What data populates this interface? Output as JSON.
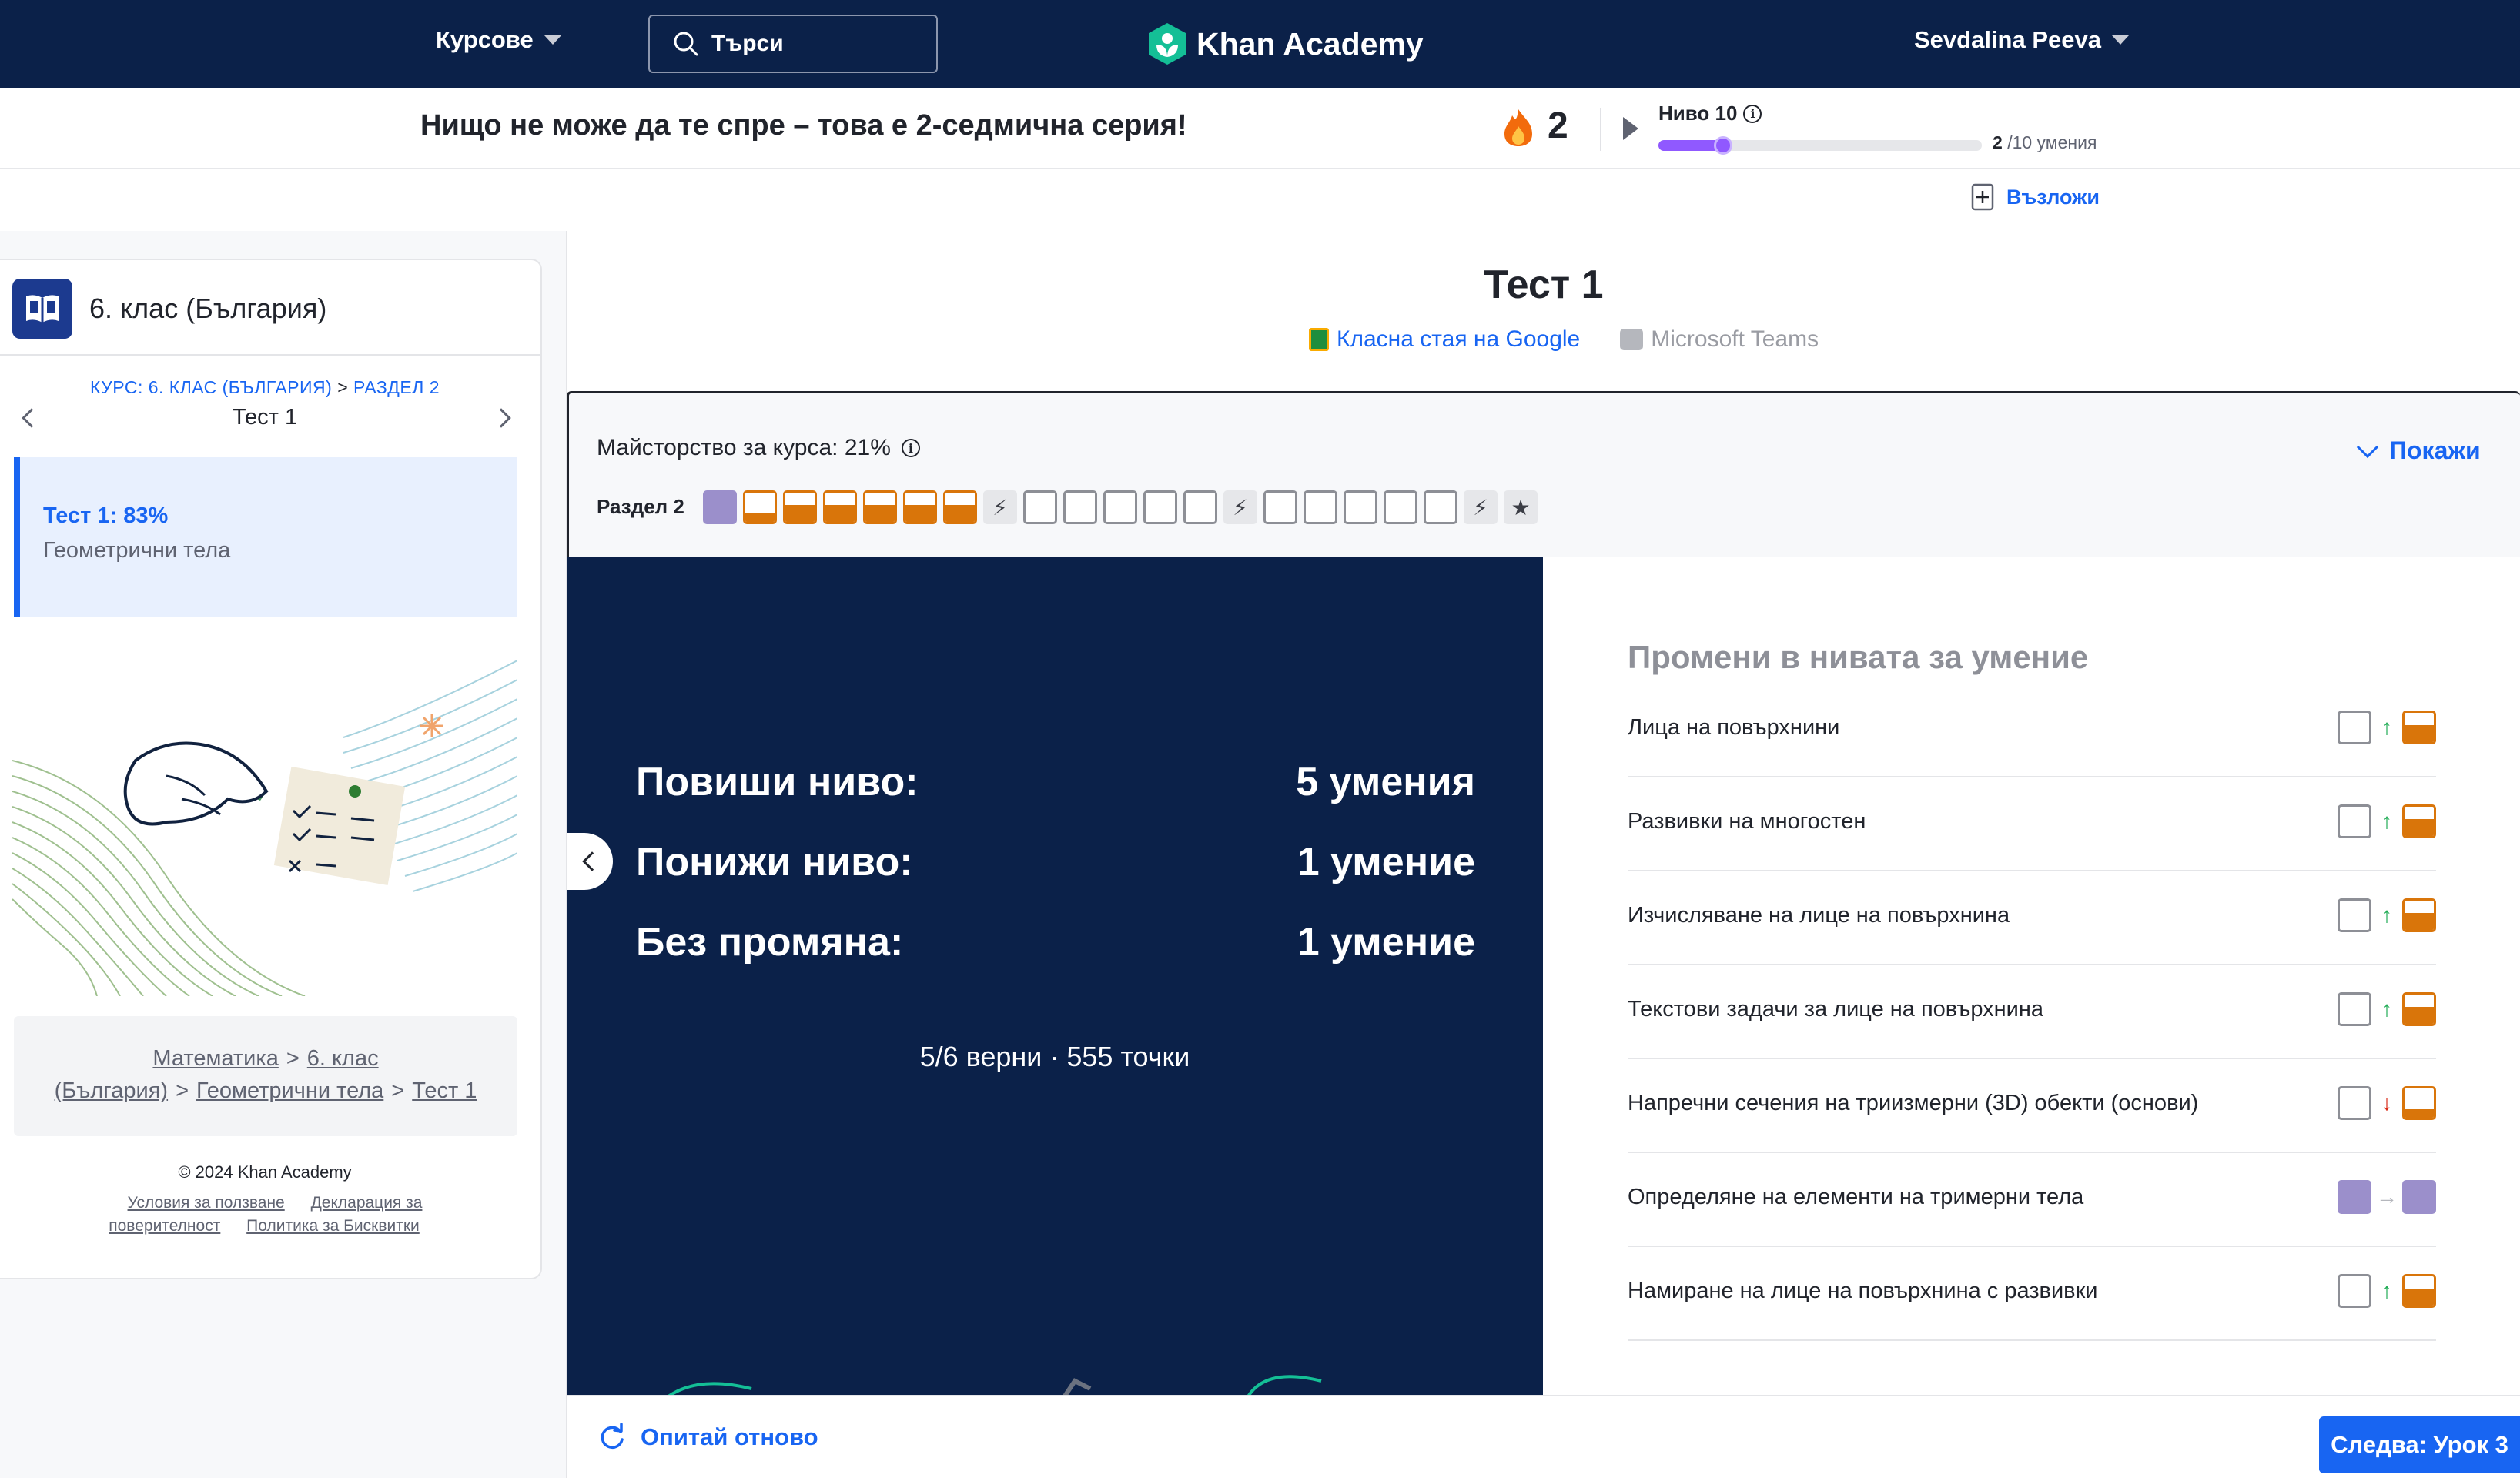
{
  "nav": {
    "courses_label": "Курсове",
    "search_placeholder": "Търси",
    "logo_text": "Khan Academy",
    "user_name": "Sevdalina Peeva"
  },
  "streak": {
    "message": "Нищо не може да те спре – това е 2-седмична серия!",
    "count": "2",
    "level_label": "Ниво 10",
    "skills_done": "2",
    "skills_total": "/10 умения",
    "level_progress": 0.2
  },
  "assign_label": "Възложи",
  "sidebar": {
    "course_title": "6. клас (България)",
    "crumb_course": "КУРС: 6. КЛАС (БЪЛГАРИЯ)",
    "crumb_sep": ">",
    "crumb_unit": "РАЗДЕЛ 2",
    "current_title": "Тест 1",
    "active_item_title": "Тест 1: 83%",
    "active_item_subtitle": "Геометрични тела",
    "breadcrumb": [
      "Математика",
      "6. клас (България)",
      "Геометрични тела",
      "Тест 1"
    ],
    "copyright": "© 2024 Khan Academy",
    "footer_links": [
      "Условия за ползване",
      "Декларация за поверителност",
      "Политика за Бисквитки"
    ]
  },
  "main": {
    "title": "Тест 1",
    "google_classroom": "Класна стая на Google",
    "ms_teams": "Microsoft Teams",
    "mastery_label": "Майсторство за курса: 21%",
    "show_label": "Покажи",
    "unit_label": "Раздел 2",
    "unit_boxes": [
      "mastered",
      "familiar",
      "proficient",
      "proficient",
      "proficient",
      "proficient",
      "proficient",
      "quiz",
      "empty",
      "empty",
      "empty",
      "empty",
      "empty",
      "quiz",
      "empty",
      "empty",
      "empty",
      "empty",
      "empty",
      "quiz",
      "challenge"
    ]
  },
  "results": {
    "leveled_up_label": "Повиши ниво:",
    "leveled_up_value": "5 умения",
    "leveled_down_label": "Понижи ниво:",
    "leveled_down_value": "1 умение",
    "no_change_label": "Без промяна:",
    "no_change_value": "1 умение",
    "score": "5/6 верни · 555 точки"
  },
  "skill_changes": {
    "title": "Промени в нивата за умение",
    "rows": [
      {
        "name": "Лица на повърхнини",
        "from": "empty",
        "dir": "up",
        "to": "proficient"
      },
      {
        "name": "Развивки на многостен",
        "from": "empty",
        "dir": "up",
        "to": "proficient"
      },
      {
        "name": "Изчисляване на лице на повърхнина",
        "from": "empty",
        "dir": "up",
        "to": "proficient"
      },
      {
        "name": "Текстови задачи за лице на повърхнина",
        "from": "empty",
        "dir": "up",
        "to": "proficient"
      },
      {
        "name": "Напречни сечения на триизмерни (3D) обекти (основи)",
        "from": "empty",
        "dir": "down",
        "to": "familiar"
      },
      {
        "name": "Определяне на елементи на тримерни тела",
        "from": "mastered",
        "dir": "same",
        "to": "mastered"
      },
      {
        "name": "Намиране на лице на повърхнина с развивки",
        "from": "empty",
        "dir": "up",
        "to": "proficient"
      }
    ]
  },
  "bottom": {
    "retry_label": "Опитай отново",
    "next_label": "Следва: Урок 3"
  },
  "colors": {
    "nav_bg": "#0b2149",
    "accent_blue": "#1865f2",
    "mastered": "#9b8fcb",
    "proficient": "#d9750a",
    "level_purple": "#9059ff"
  }
}
